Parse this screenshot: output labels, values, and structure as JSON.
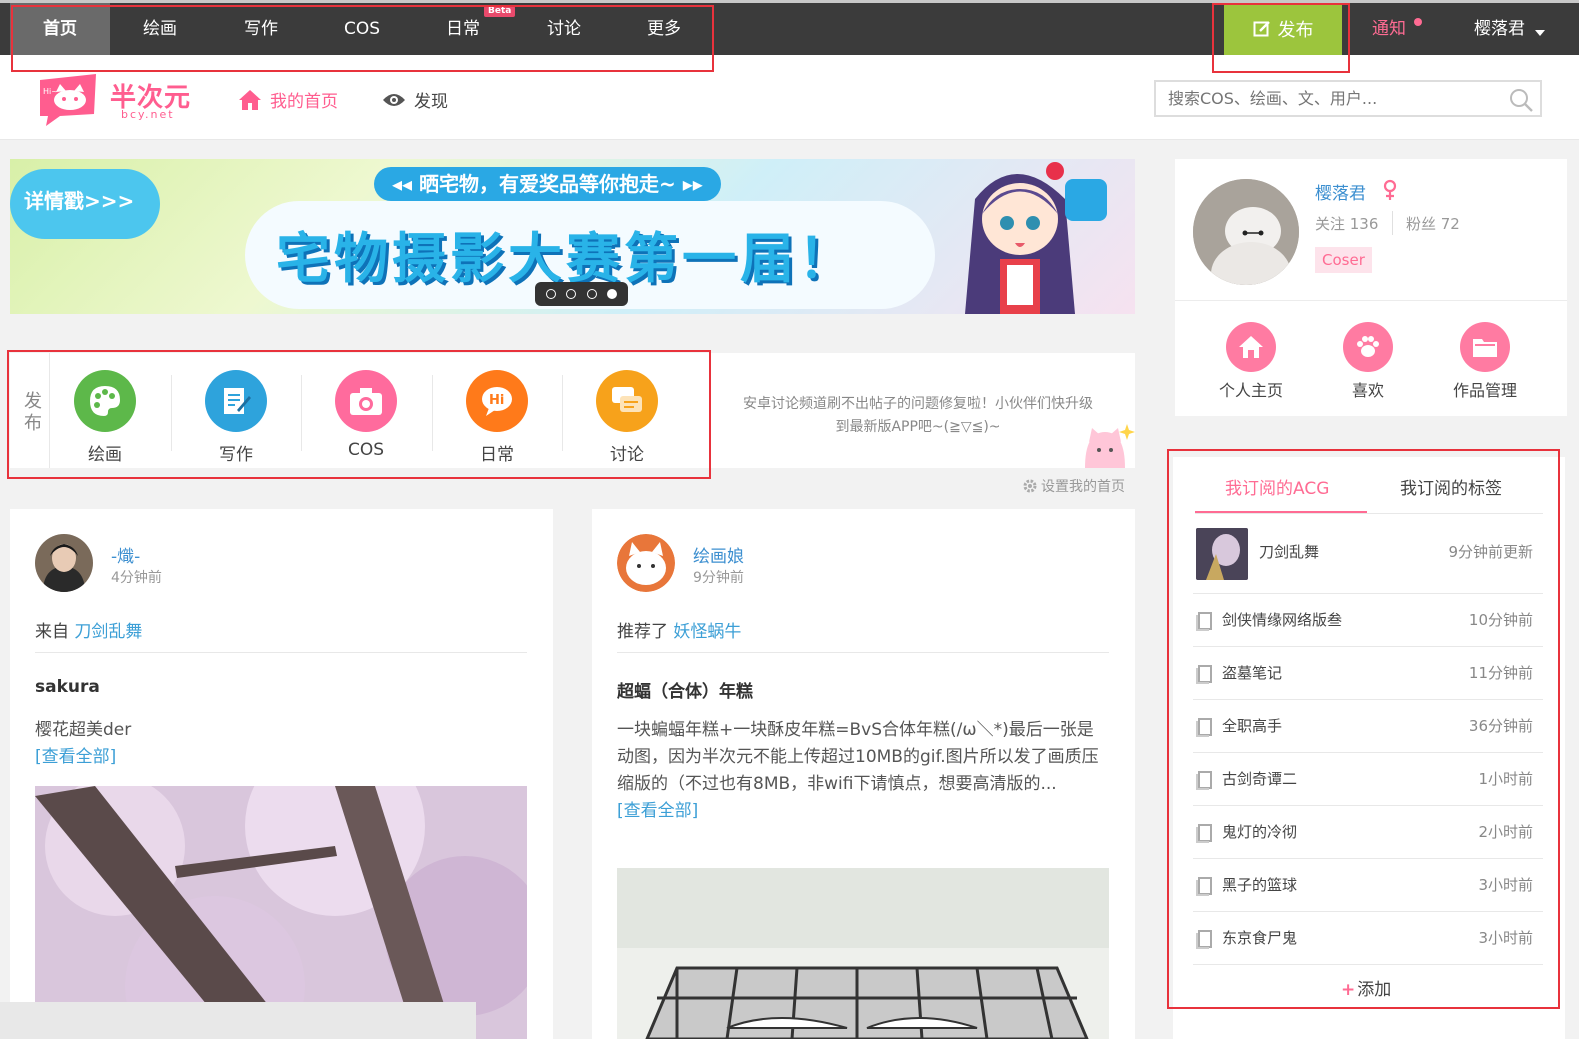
{
  "topnav": {
    "items": [
      "首页",
      "绘画",
      "写作",
      "COS",
      "日常",
      "讨论",
      "更多"
    ],
    "beta_label": "Beta",
    "publish_label": "发布",
    "notify_label": "通知",
    "username": "樱落君"
  },
  "header": {
    "logo_text": "半次元",
    "logo_sub": "bcy.net",
    "home_link": "我的首页",
    "discover_link": "发现",
    "search_placeholder": "搜索COS、绘画、文、用户..."
  },
  "banner": {
    "detail_label": "详情戳>>>",
    "subtitle": "◂◂ 晒宅物，有爱奖品等你抱走~ ▸▸",
    "title": "宅物摄影大赛第一届！",
    "active_dot": 4,
    "dot_count": 4
  },
  "publish": {
    "side_label": "发布",
    "items": [
      "绘画",
      "写作",
      "COS",
      "日常",
      "讨论"
    ],
    "notice": "安卓讨论频道刷不出帖子的问题修复啦！小伙伴们快升级到最新版APP吧~(≧▽≦)~",
    "settings_link": "设置我的首页"
  },
  "feed": [
    {
      "author": "-熾-",
      "time": "4分钟前",
      "source_prefix": "来自",
      "source_link": "刀剑乱舞",
      "title": "sakura",
      "body": "樱花超美der",
      "more": "[查看全部]"
    },
    {
      "author": "绘画娘",
      "time": "9分钟前",
      "source_prefix": "推荐了",
      "source_link": "妖怪蜗牛",
      "title": "超蝠（合体）年糕",
      "body": "一块蝙蝠年糕+一块酥皮年糕=BvS合体年糕(/ω＼*)最后一张是动图，因为半次元不能上传超过10MB的gif.图片所以发了画质压缩版的（不过也有8MB，非wifi下请慎点，想要高清版的...",
      "more": "[查看全部]"
    }
  ],
  "profile": {
    "name": "樱落君",
    "follow": "关注 136",
    "fans": "粉丝 72",
    "badge": "Coser",
    "actions": [
      "个人主页",
      "喜欢",
      "作品管理"
    ]
  },
  "subscriptions": {
    "tab_acg": "我订阅的ACG",
    "tab_tags": "我订阅的标签",
    "first": {
      "name": "刀剑乱舞",
      "time": "9分钟前更新"
    },
    "rows": [
      {
        "name": "剑侠情缘网络版叁",
        "time": "10分钟前"
      },
      {
        "name": "盗墓笔记",
        "time": "11分钟前"
      },
      {
        "name": "全职高手",
        "time": "36分钟前"
      },
      {
        "name": "古剑奇谭二",
        "time": "1小时前"
      },
      {
        "name": "鬼灯的冷彻",
        "time": "2小时前"
      },
      {
        "name": "黑子的篮球",
        "time": "3小时前"
      },
      {
        "name": "东京食尸鬼",
        "time": "3小时前"
      }
    ],
    "add_label": "添加"
  },
  "colors": {
    "brand_pink": "#ff5d8f",
    "publish_green": "#9cc53d",
    "link_blue": "#3c9fd6",
    "nav_bg": "#3b3b3b",
    "annotation_red": "#e8323c"
  }
}
